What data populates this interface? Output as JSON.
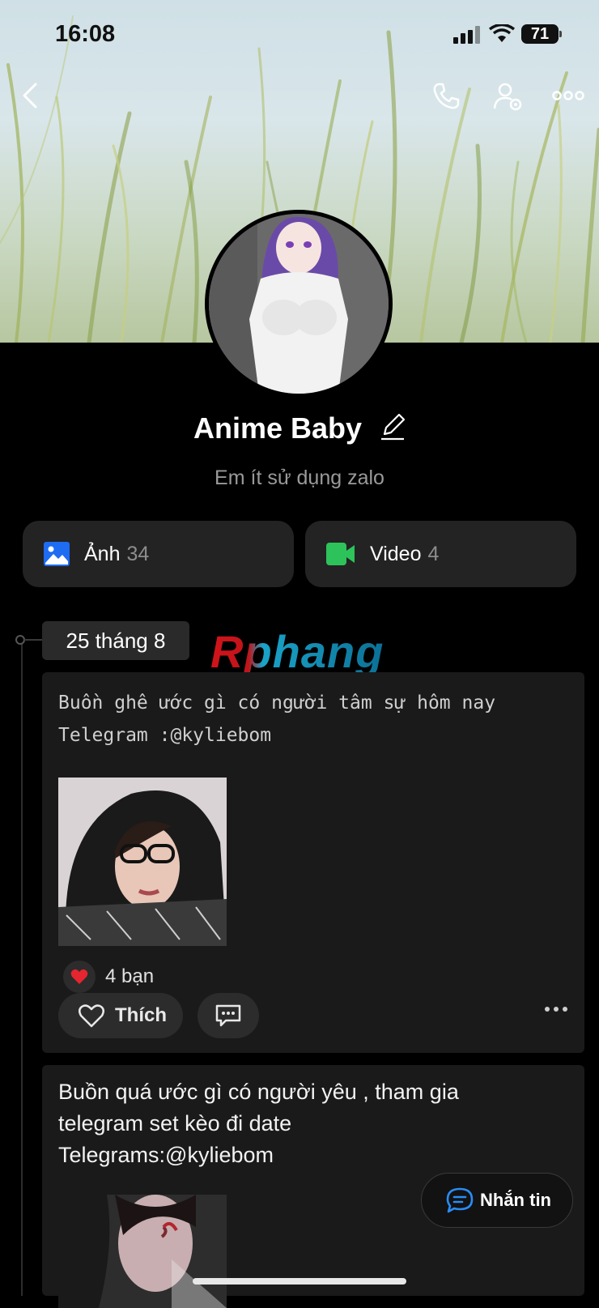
{
  "status_bar": {
    "time": "16:08",
    "battery": "71"
  },
  "profile": {
    "name": "Anime Baby",
    "status_text": "Em ít sử dụng zalo"
  },
  "media": [
    {
      "label": "Ảnh",
      "count": "34",
      "icon": "photo-icon",
      "color": "#1e6cf2"
    },
    {
      "label": "Video",
      "count": "4",
      "icon": "video-icon",
      "color": "#2ec25b"
    }
  ],
  "timeline": {
    "date": "25 tháng 8"
  },
  "watermark": "Rphang",
  "posts": [
    {
      "text": "Buồn ghê ước gì có người tâm sự hôm nay\nTelegram :@kyliebom",
      "reactions": "4 bạn",
      "like_label": "Thích"
    },
    {
      "text": "Buồn quá ước gì có người yêu , tham gia telegram set kèo đi date Telegrams:@kyliebom"
    }
  ],
  "message_button": {
    "label": "Nhắn tin"
  },
  "icons": {
    "back": "back-arrow-icon",
    "call": "phone-icon",
    "settings": "user-settings-icon",
    "more": "more-horizontal-icon",
    "edit": "pencil-icon",
    "heart": "heart-icon",
    "comment": "comment-icon",
    "message": "chat-icon"
  }
}
